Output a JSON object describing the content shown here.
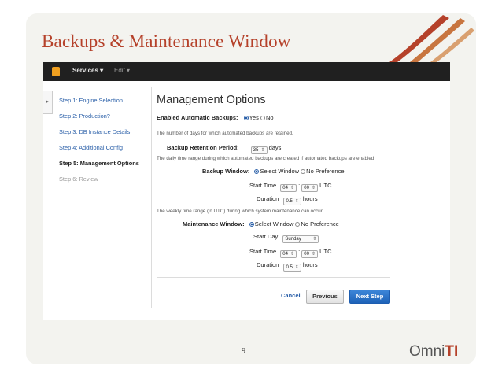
{
  "slide": {
    "title": "Backups & Maintenance Window",
    "page_number": "9",
    "logo_prefix": "Omni",
    "logo_suffix": "TI",
    "accent_color": "#b5412a"
  },
  "topnav": {
    "services_label": "Services ▾",
    "edit_label": "Edit ▾",
    "brand_icon": "aws-cube-icon"
  },
  "steps": [
    {
      "label": "Step 1:  Engine Selection"
    },
    {
      "label": "Step 2:  Production?"
    },
    {
      "label": "Step 3:  DB Instance Details"
    },
    {
      "label": "Step 4:  Additional Config"
    },
    {
      "label": "Step 5:  Management Options"
    },
    {
      "label": "Step 6:  Review"
    }
  ],
  "form": {
    "heading": "Management Options",
    "auto_backups": {
      "label": "Enabled Automatic Backups:",
      "yes": "Yes",
      "no": "No",
      "selected": "Yes"
    },
    "auto_backups_help": "The number of days for which automated backups are retained.",
    "retention": {
      "label": "Backup Retention Period:",
      "value": "35",
      "unit": "days"
    },
    "backup_window_help": "The daily time range during which automated backups are created if automated backups are enabled",
    "backup_window": {
      "label": "Backup Window:",
      "opt_select": "Select Window",
      "opt_none": "No Preference",
      "selected": "Select Window",
      "start_time_label": "Start Time",
      "hour": "04",
      "minute": "00",
      "tz": "UTC",
      "duration_label": "Duration",
      "duration": "0.5",
      "duration_unit": "hours"
    },
    "maint_window_help": "The weekly time range (in UTC) during which system maintenance can occur.",
    "maint_window": {
      "label": "Maintenance Window:",
      "opt_select": "Select Window",
      "opt_none": "No Preference",
      "selected": "Select Window",
      "start_day_label": "Start Day",
      "start_day": "Sunday",
      "start_time_label": "Start Time",
      "hour": "04",
      "minute": "00",
      "tz": "UTC",
      "duration_label": "Duration",
      "duration": "0.5",
      "duration_unit": "hours"
    }
  },
  "buttons": {
    "cancel": "Cancel",
    "previous": "Previous",
    "next": "Next Step"
  }
}
